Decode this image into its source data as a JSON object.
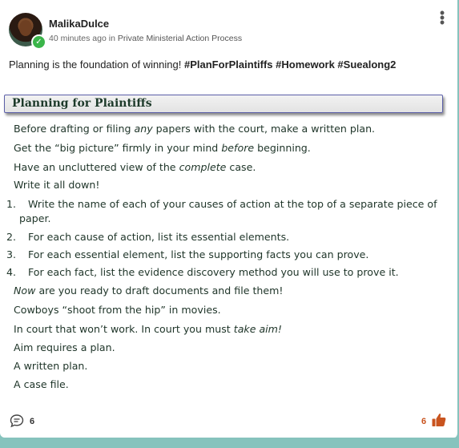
{
  "post": {
    "author": "MalikaDulce",
    "time": "40 minutes ago",
    "in_word": "in",
    "group": "Private Ministerial Action Process",
    "text_plain": "Planning is the foundation of winning! ",
    "text_tags": "#PlanForPlaintiffs #Homework #Suealong2"
  },
  "article": {
    "heading": "Planning for Plaintiffs",
    "l1a": "Before drafting or filing ",
    "l1b": "any",
    "l1c": " papers with the court, make a written plan.",
    "l2a": "Get the “big picture” firmly in your mind ",
    "l2b": "before",
    "l2c": " beginning.",
    "l3a": "Have an uncluttered view of the ",
    "l3b": "complete",
    "l3c": " case.",
    "l4": "Write it all down!",
    "n1": "1.",
    "i1a": "Write the name of each of your causes of action at the top of a separate piece of",
    "i1b": "paper.",
    "n2": "2.",
    "i2": "For each cause of action, list its essential elements.",
    "n3": "3.",
    "i3": "For each essential element, list the supporting facts you can prove.",
    "n4": "4.",
    "i4": "For each fact, list the evidence discovery method you will use to prove it.",
    "l5a": "Now",
    "l5b": " are you ready to draft documents and file them!",
    "l6": "Cowboys “shoot from the hip” in movies.",
    "l7a": "In court that won’t work. In court you must ",
    "l7b": "take aim!",
    "l8": "Aim requires a plan.",
    "l9": "A written plan.",
    "l10": "A case file."
  },
  "footer": {
    "comments": "6",
    "likes": "6"
  },
  "icons": {
    "comment": "comment-bubble-icon",
    "like": "thumbs-up-icon",
    "more": "more-vertical-icon",
    "verified": "check-icon"
  },
  "colors": {
    "accent": "#c9541f",
    "verified": "#3bb54a",
    "heading_border": "#5b5fa8"
  }
}
